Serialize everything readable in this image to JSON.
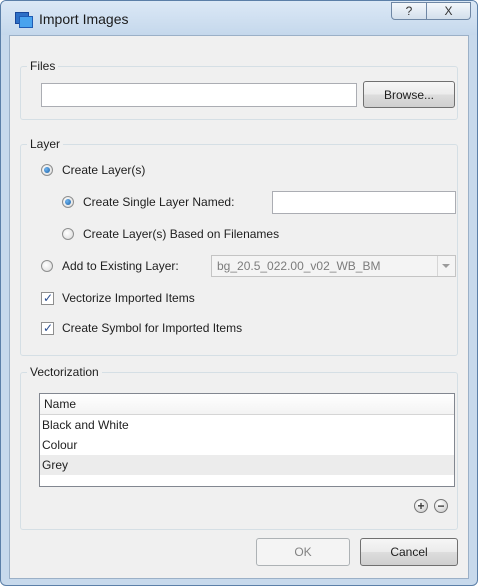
{
  "window": {
    "title": "Import Images",
    "help_glyph": "?",
    "close_glyph": "X"
  },
  "files": {
    "group_label": "Files",
    "path_value": "",
    "browse_label": "Browse..."
  },
  "layer": {
    "group_label": "Layer",
    "create_layers": {
      "label": "Create Layer(s)",
      "selected": true
    },
    "create_single": {
      "label": "Create Single Layer Named:",
      "selected": true,
      "value": ""
    },
    "create_based": {
      "label": "Create Layer(s) Based on Filenames",
      "selected": false
    },
    "add_existing": {
      "label": "Add to Existing Layer:",
      "selected": false,
      "combo_value": "bg_20.5_022.00_v02_WB_BM"
    },
    "vectorize": {
      "label": "Vectorize Imported Items",
      "checked": true,
      "mark": "✓"
    },
    "symbol": {
      "label": "Create Symbol for Imported Items",
      "checked": true,
      "mark": "✓"
    }
  },
  "vectorization": {
    "group_label": "Vectorization",
    "column_header": "Name",
    "rows": [
      "Black and White",
      "Colour",
      "Grey"
    ],
    "selected_row": "Grey",
    "add_glyph": "+",
    "remove_glyph": "−"
  },
  "footer": {
    "ok_label": "OK",
    "cancel_label": "Cancel"
  }
}
